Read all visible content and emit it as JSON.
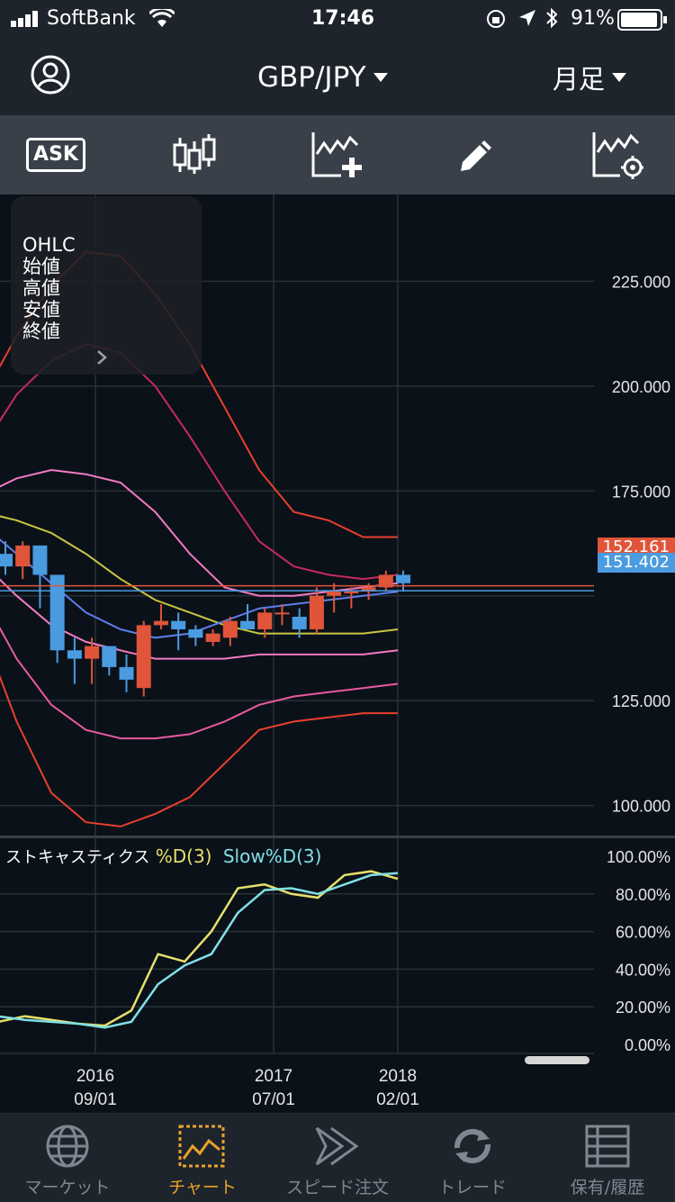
{
  "status_bar": {
    "carrier": "SoftBank",
    "time": "17:46",
    "battery": "91%"
  },
  "header": {
    "pair": "GBP/JPY",
    "timeframe": "月足"
  },
  "toolbar": {
    "ask_label": "ASK"
  },
  "ohlc_panel": {
    "lines": [
      "OHLC",
      "始値",
      "高値",
      "安値",
      "終値"
    ]
  },
  "price_tags": {
    "ask": "152.161",
    "bid": "151.402"
  },
  "stochastic": {
    "title": "ストキャスティクス",
    "d_label": "%D(3)",
    "slow_label": "Slow%D(3)"
  },
  "tabs": [
    {
      "label": "マーケット",
      "icon": "globe-icon"
    },
    {
      "label": "チャート",
      "icon": "chart-icon"
    },
    {
      "label": "スピード注文",
      "icon": "speed-icon"
    },
    {
      "label": "トレード",
      "icon": "trade-icon"
    },
    {
      "label": "保有/履歴",
      "icon": "list-icon"
    }
  ],
  "colors": {
    "candle_up": "#e0553a",
    "candle_down": "#4a9be0",
    "percent_d": "#e6e06a",
    "slow_d": "#7fe0e6",
    "active_tab": "#e8a12c"
  },
  "chart_data": [
    {
      "type": "candlestick",
      "x_ticks": [
        {
          "top": "2016",
          "bottom": "09/01"
        },
        {
          "top": "2017",
          "bottom": "07/01"
        },
        {
          "top": "2018",
          "bottom": "02/01"
        }
      ],
      "y_ticks": [
        "225.000",
        "200.000",
        "175.000",
        "125.000",
        "100.000"
      ],
      "y_range": [
        75,
        250
      ],
      "candles": [
        {
          "o": 160,
          "h": 163,
          "l": 155,
          "c": 157
        },
        {
          "o": 157,
          "h": 163,
          "l": 154,
          "c": 162
        },
        {
          "o": 162,
          "h": 162,
          "l": 147,
          "c": 155
        },
        {
          "o": 155,
          "h": 155,
          "l": 134,
          "c": 137
        },
        {
          "o": 137,
          "h": 140,
          "l": 129,
          "c": 135
        },
        {
          "o": 135,
          "h": 140,
          "l": 129,
          "c": 138
        },
        {
          "o": 138,
          "h": 138,
          "l": 131,
          "c": 133
        },
        {
          "o": 133,
          "h": 136,
          "l": 127,
          "c": 130
        },
        {
          "o": 128,
          "h": 144,
          "l": 126,
          "c": 143
        },
        {
          "o": 143,
          "h": 148,
          "l": 142,
          "c": 144
        },
        {
          "o": 144,
          "h": 146,
          "l": 137,
          "c": 142
        },
        {
          "o": 142,
          "h": 143,
          "l": 138,
          "c": 140
        },
        {
          "o": 139,
          "h": 142,
          "l": 138,
          "c": 141
        },
        {
          "o": 140,
          "h": 145,
          "l": 138,
          "c": 144
        },
        {
          "o": 144,
          "h": 148,
          "l": 142,
          "c": 142
        },
        {
          "o": 142,
          "h": 147,
          "l": 140,
          "c": 146
        },
        {
          "o": 146,
          "h": 148,
          "l": 143,
          "c": 146
        },
        {
          "o": 145,
          "h": 147,
          "l": 140,
          "c": 142
        },
        {
          "o": 142,
          "h": 152,
          "l": 141,
          "c": 150
        },
        {
          "o": 150,
          "h": 153,
          "l": 146,
          "c": 151
        },
        {
          "o": 151,
          "h": 152,
          "l": 147,
          "c": 151
        },
        {
          "o": 151,
          "h": 153,
          "l": 149,
          "c": 152
        },
        {
          "o": 152,
          "h": 156,
          "l": 151,
          "c": 155
        },
        {
          "o": 155,
          "h": 156,
          "l": 151,
          "c": 153
        }
      ],
      "overlays": [
        {
          "color": "#e8402c",
          "values": [
            197,
            212,
            224,
            232,
            231,
            222,
            210,
            195,
            180,
            170,
            168,
            164,
            164
          ]
        },
        {
          "color": "#c62a5f",
          "values": [
            185,
            198,
            206,
            210,
            208,
            200,
            188,
            175,
            163,
            157,
            155,
            154,
            155
          ]
        },
        {
          "color": "#f27ac4",
          "values": [
            174,
            178,
            180,
            179,
            177,
            170,
            160,
            152,
            150,
            150,
            151,
            152,
            153
          ]
        },
        {
          "color": "#c9c640",
          "values": [
            170,
            168,
            165,
            160,
            154,
            149,
            146,
            143,
            141,
            141,
            141,
            141,
            142
          ]
        },
        {
          "color": "#5c7ee8",
          "values": [
            167,
            160,
            153,
            146,
            142,
            140,
            141,
            144,
            147,
            148,
            149,
            150,
            151
          ]
        },
        {
          "color": "#f27ac4",
          "values": [
            158,
            150,
            143,
            139,
            137,
            135,
            135,
            135,
            136,
            136,
            136,
            136,
            137
          ]
        },
        {
          "color": "#e85aa0",
          "values": [
            150,
            135,
            124,
            118,
            116,
            116,
            117,
            120,
            124,
            126,
            127,
            128,
            129
          ]
        },
        {
          "color": "#e8402c",
          "values": [
            142,
            120,
            103,
            96,
            95,
            98,
            102,
            110,
            118,
            120,
            121,
            122,
            122
          ]
        }
      ]
    },
    {
      "type": "line",
      "title": "ストキャスティクス",
      "y_ticks": [
        "100.00%",
        "80.00%",
        "60.00%",
        "40.00%",
        "20.00%",
        "0.00%"
      ],
      "y_range": [
        0,
        100
      ],
      "series": [
        {
          "name": "%D(3)",
          "color": "#e6e06a",
          "values": [
            12,
            15,
            13,
            11,
            10,
            18,
            48,
            44,
            60,
            83,
            85,
            80,
            78,
            90,
            92,
            88
          ]
        },
        {
          "name": "Slow%D(3)",
          "color": "#7fe0e6",
          "values": [
            15,
            13,
            12,
            11,
            9,
            12,
            32,
            42,
            48,
            70,
            82,
            83,
            80,
            85,
            90,
            91
          ]
        }
      ]
    }
  ]
}
